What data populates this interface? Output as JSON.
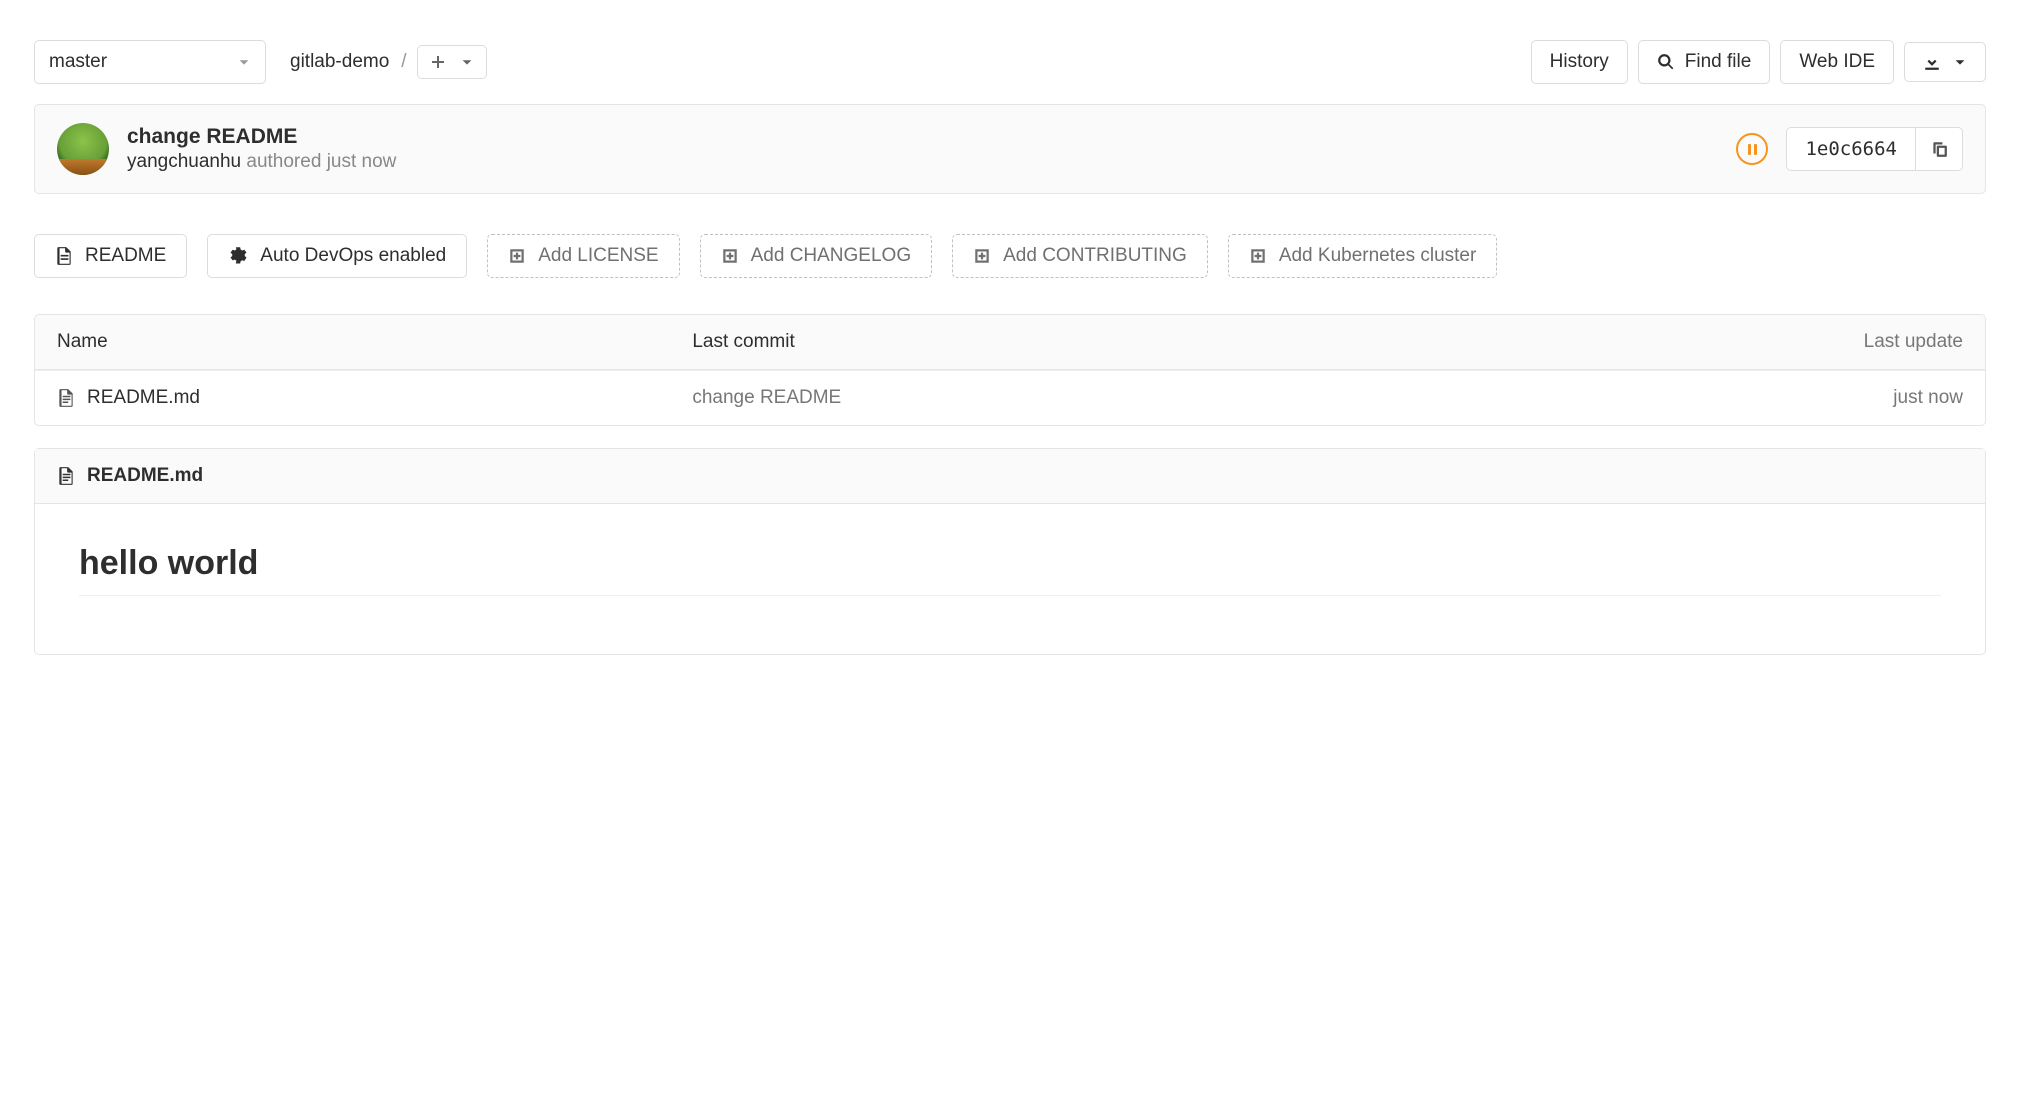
{
  "branch": {
    "selected": "master"
  },
  "breadcrumb": {
    "repo": "gitlab-demo"
  },
  "toolbar": {
    "history": "History",
    "find_file": "Find file",
    "web_ide": "Web IDE"
  },
  "commit": {
    "title": "change README",
    "author": "yangchuanhu",
    "authored_label": "authored",
    "when": "just now",
    "sha_short": "1e0c6664"
  },
  "quick_links": {
    "readme": "README",
    "auto_devops": "Auto DevOps enabled",
    "add_license": "Add LICENSE",
    "add_changelog": "Add CHANGELOG",
    "add_contributing": "Add CONTRIBUTING",
    "add_k8s": "Add Kubernetes cluster"
  },
  "files": {
    "columns": {
      "name": "Name",
      "last_commit": "Last commit",
      "last_update": "Last update"
    },
    "rows": [
      {
        "name": "README.md",
        "last_commit": "change README",
        "last_update": "just now"
      }
    ]
  },
  "readme": {
    "filename": "README.md",
    "content_heading": "hello world"
  }
}
